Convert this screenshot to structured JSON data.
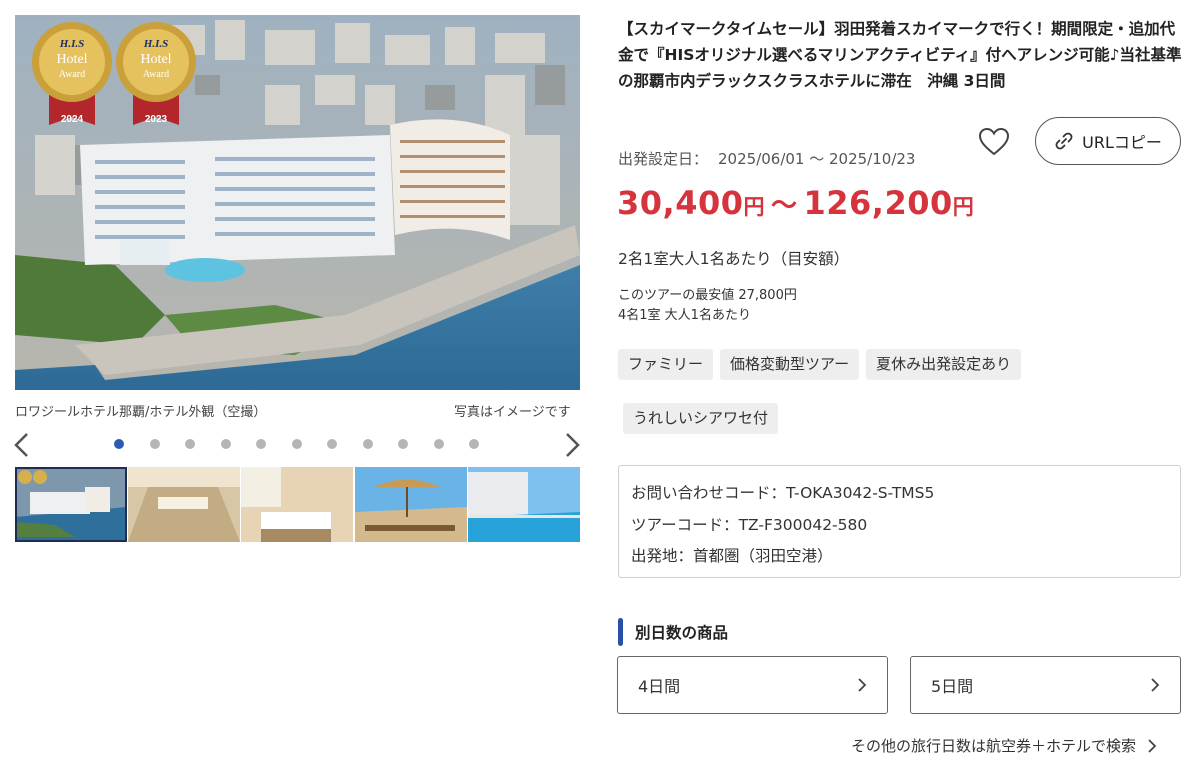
{
  "gallery": {
    "main_image_alt": "ロワジールホテル那覇/ホテル外観（空撮）",
    "caption": "ロワジールホテル那覇/ホテル外観（空撮）",
    "note": "写真はイメージです",
    "awards": [
      {
        "brand": "H.I.S",
        "name1": "Hotel",
        "name2": "Award",
        "year": "2024"
      },
      {
        "brand": "H.I.S",
        "name1": "Hotel",
        "name2": "Award",
        "year": "2023"
      }
    ],
    "dot_count": 11,
    "active_dot": 0,
    "thumbnail_count": 5,
    "icons": {
      "prev": "chevron-left-icon",
      "next": "chevron-right-icon"
    }
  },
  "tour": {
    "title": "【スカイマークタイムセール】羽田発着スカイマークで行く！期間限定・追加代金で『HISオリジナル選べるマリンアクティビティ』付へアレンジ可能♪当社基準の那覇市内デラックスクラスホテルに滞在　沖縄 3日間",
    "period_label": "出発設定日：",
    "period_value": "2025/06/01 〜 2025/10/23",
    "price_min": "30,400",
    "price_max": "126,200",
    "price_unit": "円",
    "price_sep": "〜",
    "price_basis": "2名1室大人1名あたり（目安額）",
    "lowest_price": "このツアーの最安値 27,800円",
    "lowest_basis": "4名1室 大人1名あたり",
    "tags": [
      "ファミリー",
      "価格変動型ツアー",
      "夏休み出発設定あり",
      "うれしいシアワセ付"
    ],
    "inquiry_code": "お問い合わせコード：T-OKA3042-S-TMS5",
    "tour_code": "ツアーコード：TZ-F300042-580",
    "departure": "出発地：首都圏（羽田空港）"
  },
  "actions": {
    "favorite_icon": "heart-icon",
    "url_copy_label": "URLコピー",
    "url_copy_icon": "link-icon"
  },
  "other_days": {
    "section_title": "別日数の商品",
    "options": [
      "4日間",
      "5日間"
    ],
    "search_link": "その他の旅行日数は航空券＋ホテルで検索"
  },
  "colors": {
    "price_red": "#d5343d",
    "accent_blue": "#2850a6",
    "active_dot": "#2b5bb5",
    "tag_bg": "#eeeeee"
  }
}
